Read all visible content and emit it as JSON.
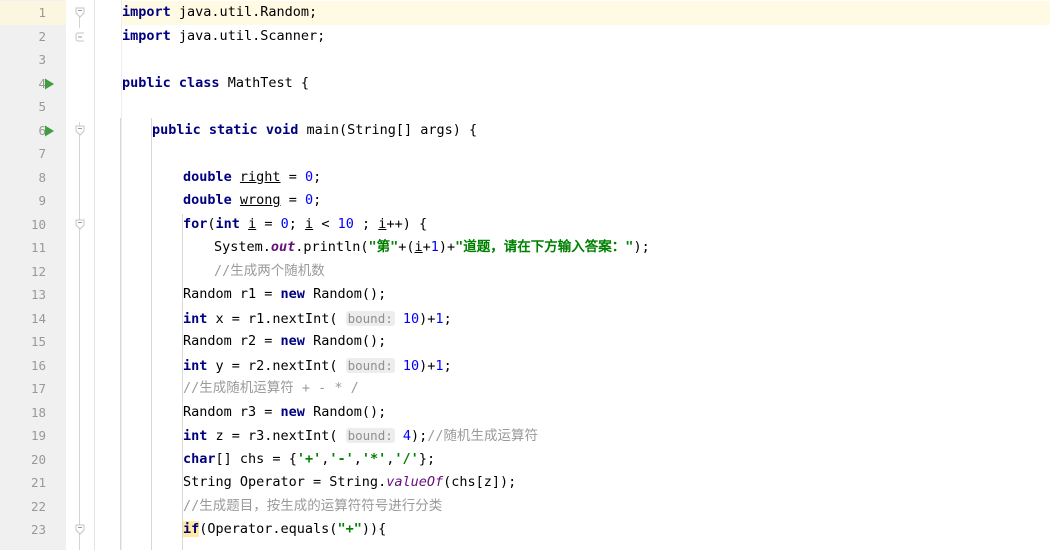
{
  "editor": {
    "app": "java-code-editor",
    "language": "Java",
    "colors": {
      "background": "#ffffff",
      "gutter": "#f0f0f0",
      "caret_line": "#fffae3",
      "keyword": "#000080",
      "string": "#008000",
      "number": "#0000ff",
      "comment": "#9a9a9a",
      "static_field": "#660e7a",
      "param_hint_bg": "#ededed",
      "identifier_highlight": "#ffeaa0",
      "run_arrow": "#3f9d3f",
      "line_number": "#999999"
    },
    "first_visible_line": 1,
    "last_visible_line": 23,
    "caret_line_number": 1,
    "run_gutter_lines": [
      4,
      6
    ],
    "fold_marker_lines": [
      1,
      2,
      6,
      10,
      23
    ]
  },
  "lines": [
    {
      "n": 1,
      "indent": 0,
      "text": "import java.util.Random;"
    },
    {
      "n": 2,
      "indent": 0,
      "text": "import java.util.Scanner;"
    },
    {
      "n": 3,
      "indent": 0,
      "text": ""
    },
    {
      "n": 4,
      "indent": 0,
      "text": "public class MathTest {"
    },
    {
      "n": 5,
      "indent": 0,
      "text": ""
    },
    {
      "n": 6,
      "indent": 1,
      "text": "public static void main(String[] args) {"
    },
    {
      "n": 7,
      "indent": 1,
      "text": ""
    },
    {
      "n": 8,
      "indent": 2,
      "text": "double right = 0;"
    },
    {
      "n": 9,
      "indent": 2,
      "text": "double wrong = 0;"
    },
    {
      "n": 10,
      "indent": 2,
      "text": "for(int i = 0; i < 10 ; i++) {"
    },
    {
      "n": 11,
      "indent": 3,
      "text": "System.out.println(\"第\"+(i+1)+\"道题，请在下方输入答案：\");"
    },
    {
      "n": 12,
      "indent": 3,
      "text": "//生成两个随机数"
    },
    {
      "n": 13,
      "indent": 3,
      "text": "Random r1 = new Random();"
    },
    {
      "n": 14,
      "indent": 3,
      "text": "int x = r1.nextInt( bound: 10)+1;"
    },
    {
      "n": 15,
      "indent": 3,
      "text": "Random r2 = new Random();"
    },
    {
      "n": 16,
      "indent": 3,
      "text": "int y = r2.nextInt( bound: 10)+1;"
    },
    {
      "n": 17,
      "indent": 3,
      "text": "//生成随机运算符 + - * /"
    },
    {
      "n": 18,
      "indent": 3,
      "text": "Random r3 = new Random();"
    },
    {
      "n": 19,
      "indent": 3,
      "text": "int z = r3.nextInt( bound: 4);//随机生成运算符"
    },
    {
      "n": 20,
      "indent": 3,
      "text": "char[] chs = {'+','-','*','/'};"
    },
    {
      "n": 21,
      "indent": 3,
      "text": "String Operator = String.valueOf(chs[z]);"
    },
    {
      "n": 22,
      "indent": 3,
      "text": "//生成题目，按生成的运算符符号进行分类"
    },
    {
      "n": 23,
      "indent": 3,
      "text": "if(Operator.equals(\"+\")){"
    }
  ],
  "tokens": {
    "kw_import": "import",
    "kw_public": "public",
    "kw_class": "class",
    "kw_static": "static",
    "kw_void": "void",
    "kw_double": "double",
    "kw_int": "int",
    "kw_char": "char",
    "kw_new": "new",
    "kw_for": "for",
    "kw_if": "if",
    "type_name": "MathTest",
    "method_main": "main",
    "param_hint_bound": "bound:",
    "string_di": "\"第\"",
    "string_question": "\"道题，请在下方输入答案：\"",
    "comment_two_randoms": "//生成两个随机数",
    "comment_random_op": "//生成随机运算符 + - * /",
    "comment_gen_op": "//随机生成运算符",
    "comment_classify": "//生成题目，按生成的运算符符号进行分类",
    "static_out": "out"
  }
}
